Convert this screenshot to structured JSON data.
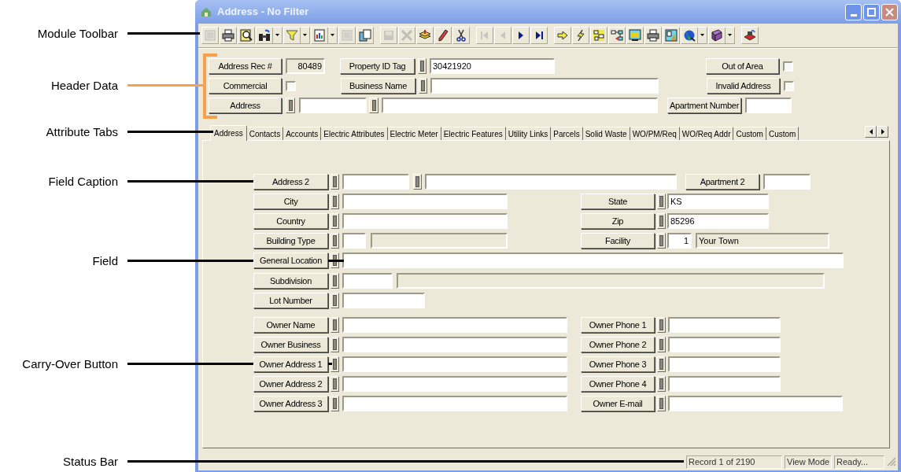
{
  "annotations": [
    {
      "label": "Module Toolbar"
    },
    {
      "label": "Header Data"
    },
    {
      "label": "Attribute Tabs"
    },
    {
      "label": "Field Caption"
    },
    {
      "label": "Field"
    },
    {
      "label": "Carry-Over Button"
    },
    {
      "label": "Status Bar"
    }
  ],
  "window": {
    "title": "Address - No Filter"
  },
  "toolbar": [
    [
      {
        "kind": "form",
        "disabled": true
      },
      {
        "kind": "printer",
        "disabled": false
      },
      {
        "kind": "preview",
        "disabled": false
      },
      {
        "kind": "binoculars",
        "disabled": false,
        "dropdown": true
      },
      {
        "kind": "funnel",
        "disabled": false,
        "dropdown": true
      },
      {
        "kind": "report",
        "disabled": false,
        "dropdown": true
      },
      {
        "kind": "form",
        "disabled": true
      },
      {
        "kind": "copy",
        "disabled": false
      }
    ],
    [
      {
        "kind": "save",
        "disabled": true
      },
      {
        "kind": "delete",
        "disabled": true
      },
      {
        "kind": "stack",
        "disabled": false
      },
      {
        "kind": "pencil",
        "disabled": false
      },
      {
        "kind": "scissors",
        "disabled": false
      }
    ],
    [
      {
        "kind": "first",
        "disabled": true
      },
      {
        "kind": "previous",
        "disabled": true
      },
      {
        "kind": "next",
        "disabled": false
      },
      {
        "kind": "last",
        "disabled": false
      }
    ],
    [
      {
        "kind": "arrow",
        "disabled": false
      },
      {
        "kind": "lightning",
        "disabled": false
      },
      {
        "kind": "diagram",
        "disabled": false
      },
      {
        "kind": "nodes",
        "disabled": false
      },
      {
        "kind": "monitor",
        "disabled": false
      },
      {
        "kind": "printer",
        "disabled": false
      },
      {
        "kind": "map",
        "disabled": false
      },
      {
        "kind": "globe",
        "disabled": false,
        "dropdown": true
      },
      {
        "kind": "book",
        "disabled": false,
        "dropdown": true
      }
    ],
    [
      {
        "kind": "stamp",
        "disabled": false
      }
    ]
  ],
  "header": [
    [
      {
        "kind": "caption",
        "label": "Address Rec #"
      },
      {
        "kind": "readonly",
        "value": "80489"
      },
      {
        "kind": "caption",
        "label": "Property ID Tag"
      },
      {
        "kind": "carry"
      },
      {
        "kind": "input",
        "value": "30421920"
      },
      {
        "kind": "caption",
        "label": "Out of Area"
      },
      {
        "kind": "checkbox",
        "checked": false
      }
    ],
    [
      {
        "kind": "caption",
        "label": "Commercial"
      },
      {
        "kind": "checkbox",
        "checked": false
      },
      {
        "kind": "caption",
        "label": "Business Name"
      },
      {
        "kind": "carry"
      },
      {
        "kind": "input"
      },
      {
        "kind": "caption",
        "label": "Invalid Address"
      },
      {
        "kind": "checkbox",
        "checked": false
      }
    ],
    [
      {
        "kind": "caption",
        "label": "Address"
      },
      {
        "kind": "carry"
      },
      {
        "kind": "input"
      },
      {
        "kind": "carry"
      },
      {
        "kind": "input"
      },
      {
        "kind": "caption",
        "label": "Apartment Number"
      },
      {
        "kind": "input"
      }
    ]
  ],
  "tabs": [
    {
      "label": "Address",
      "selected": true
    },
    {
      "label": "Contacts",
      "selected": false
    },
    {
      "label": "Accounts",
      "selected": false
    },
    {
      "label": "Electric Attributes",
      "selected": false
    },
    {
      "label": "Electric Meter",
      "selected": false
    },
    {
      "label": "Electric Features",
      "selected": false
    },
    {
      "label": "Utility Links",
      "selected": false
    },
    {
      "label": "Parcels",
      "selected": false
    },
    {
      "label": "Solid Waste",
      "selected": false
    },
    {
      "label": "WO/PM/Req",
      "selected": false
    },
    {
      "label": "WO/Req Addr",
      "selected": false
    },
    {
      "label": "Custom",
      "selected": false
    },
    {
      "label": "Custom",
      "selected": false
    }
  ],
  "form": [
    [
      {
        "kind": "caption",
        "label": "Address 2"
      },
      {
        "kind": "carry"
      },
      {
        "kind": "input"
      },
      {
        "kind": "carry"
      },
      {
        "kind": "input"
      },
      {
        "kind": "caption",
        "label": "Apartment 2"
      },
      {
        "kind": "input"
      }
    ],
    [
      {
        "kind": "caption",
        "label": "City"
      },
      {
        "kind": "carry"
      },
      {
        "kind": "input"
      },
      {
        "kind": "caption",
        "label": "State"
      },
      {
        "kind": "carry"
      },
      {
        "kind": "input",
        "value": "KS"
      }
    ],
    [
      {
        "kind": "caption",
        "label": "Country"
      },
      {
        "kind": "carry"
      },
      {
        "kind": "input"
      },
      {
        "kind": "caption",
        "label": "Zip"
      },
      {
        "kind": "carry"
      },
      {
        "kind": "input",
        "value": "85296"
      }
    ],
    [
      {
        "kind": "caption",
        "label": "Building Type"
      },
      {
        "kind": "carry"
      },
      {
        "kind": "input"
      },
      {
        "kind": "readonly"
      },
      {
        "kind": "caption",
        "label": "Facility"
      },
      {
        "kind": "carry"
      },
      {
        "kind": "input",
        "value": "1"
      },
      {
        "kind": "readonly",
        "value": "Your Town"
      }
    ],
    [
      {
        "kind": "caption",
        "label": "General Location"
      },
      {
        "kind": "carry"
      },
      {
        "kind": "input"
      }
    ],
    [
      {
        "kind": "caption",
        "label": "Subdivision"
      },
      {
        "kind": "carry"
      },
      {
        "kind": "input"
      },
      {
        "kind": "readonly"
      }
    ],
    [
      {
        "kind": "caption",
        "label": "Lot Number"
      },
      {
        "kind": "carry"
      },
      {
        "kind": "input"
      }
    ],
    [
      {
        "kind": "caption",
        "label": "Owner Name"
      },
      {
        "kind": "carry"
      },
      {
        "kind": "input"
      },
      {
        "kind": "caption",
        "label": "Owner Phone 1"
      },
      {
        "kind": "carry"
      },
      {
        "kind": "input"
      }
    ],
    [
      {
        "kind": "caption",
        "label": "Owner Business"
      },
      {
        "kind": "carry"
      },
      {
        "kind": "input"
      },
      {
        "kind": "caption",
        "label": "Owner Phone 2"
      },
      {
        "kind": "carry"
      },
      {
        "kind": "input"
      }
    ],
    [
      {
        "kind": "caption",
        "label": "Owner Address 1"
      },
      {
        "kind": "carry"
      },
      {
        "kind": "input"
      },
      {
        "kind": "caption",
        "label": "Owner Phone 3"
      },
      {
        "kind": "carry"
      },
      {
        "kind": "input"
      }
    ],
    [
      {
        "kind": "caption",
        "label": "Owner Address 2"
      },
      {
        "kind": "carry"
      },
      {
        "kind": "input"
      },
      {
        "kind": "caption",
        "label": "Owner Phone 4"
      },
      {
        "kind": "carry"
      },
      {
        "kind": "input"
      }
    ],
    [
      {
        "kind": "caption",
        "label": "Owner Address 3"
      },
      {
        "kind": "carry"
      },
      {
        "kind": "input"
      },
      {
        "kind": "caption",
        "label": "Owner E-mail"
      },
      {
        "kind": "carry"
      },
      {
        "kind": "input"
      }
    ]
  ],
  "status_bar": [
    {
      "text": "Record 1 of 2190"
    },
    {
      "text": "View Mode"
    },
    {
      "text": "Ready..."
    }
  ]
}
